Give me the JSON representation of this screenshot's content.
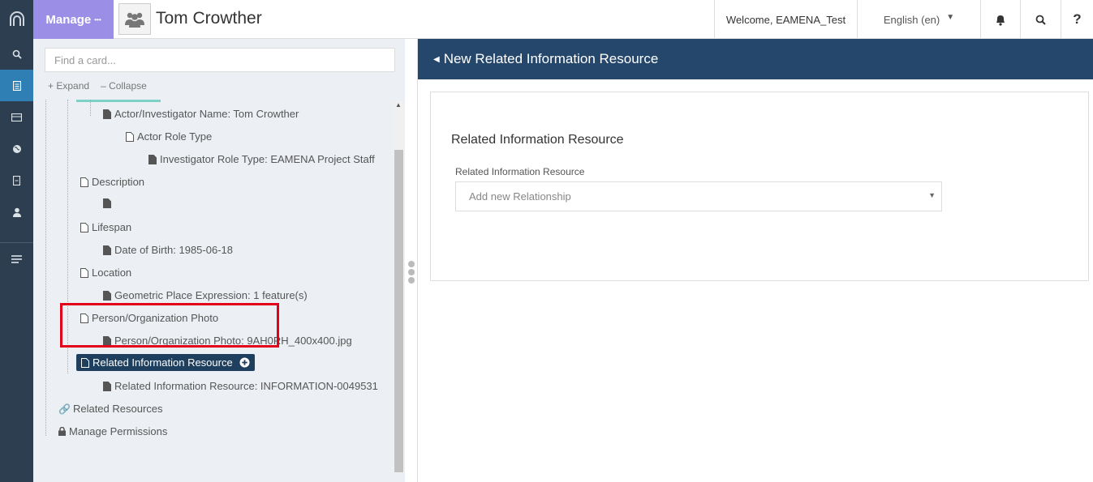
{
  "header": {
    "manage_label": "Manage",
    "manage_dots": "•••",
    "resource_title": "Tom Crowther",
    "welcome": "Welcome, EAMENA_Test",
    "language": "English (en)",
    "help": "?"
  },
  "sidebar": {
    "icons": [
      "search-icon",
      "resource-editor-icon",
      "card-list-icon",
      "map-icon",
      "bookmark-icon",
      "user-icon",
      "menu-lines-icon"
    ]
  },
  "tree": {
    "search_placeholder": "Find a card...",
    "expand_label": "Expand",
    "collapse_label": "Collapse",
    "nodes": [
      "Actor/Investigator Name: Tom Crowther",
      "Actor Role Type",
      "Investigator Role Type: EAMENA Project Staff",
      "Description",
      "",
      "Lifespan",
      "Date of Birth: 1985-06-18",
      "Location",
      "Geometric Place Expression: 1 feature(s)",
      "Person/Organization Photo",
      "Person/Organization Photo: 9AH0RH_400x400.jpg",
      "Related Information Resource",
      "Related Information Resource: INFORMATION-0049531",
      "Related Resources",
      "Manage Permissions"
    ]
  },
  "card": {
    "header_title": "New Related Information Resource",
    "section_title": "Related Information Resource",
    "field_label": "Related Information Resource",
    "select_placeholder": "Add new Relationship"
  },
  "colors": {
    "rail": "#2c3e50",
    "rail_active": "#2f7fb5",
    "manage": "#9b8ee6",
    "card_header": "#24476b",
    "selected_node": "#1f3f5e",
    "highlight_box": "#e3001b"
  }
}
